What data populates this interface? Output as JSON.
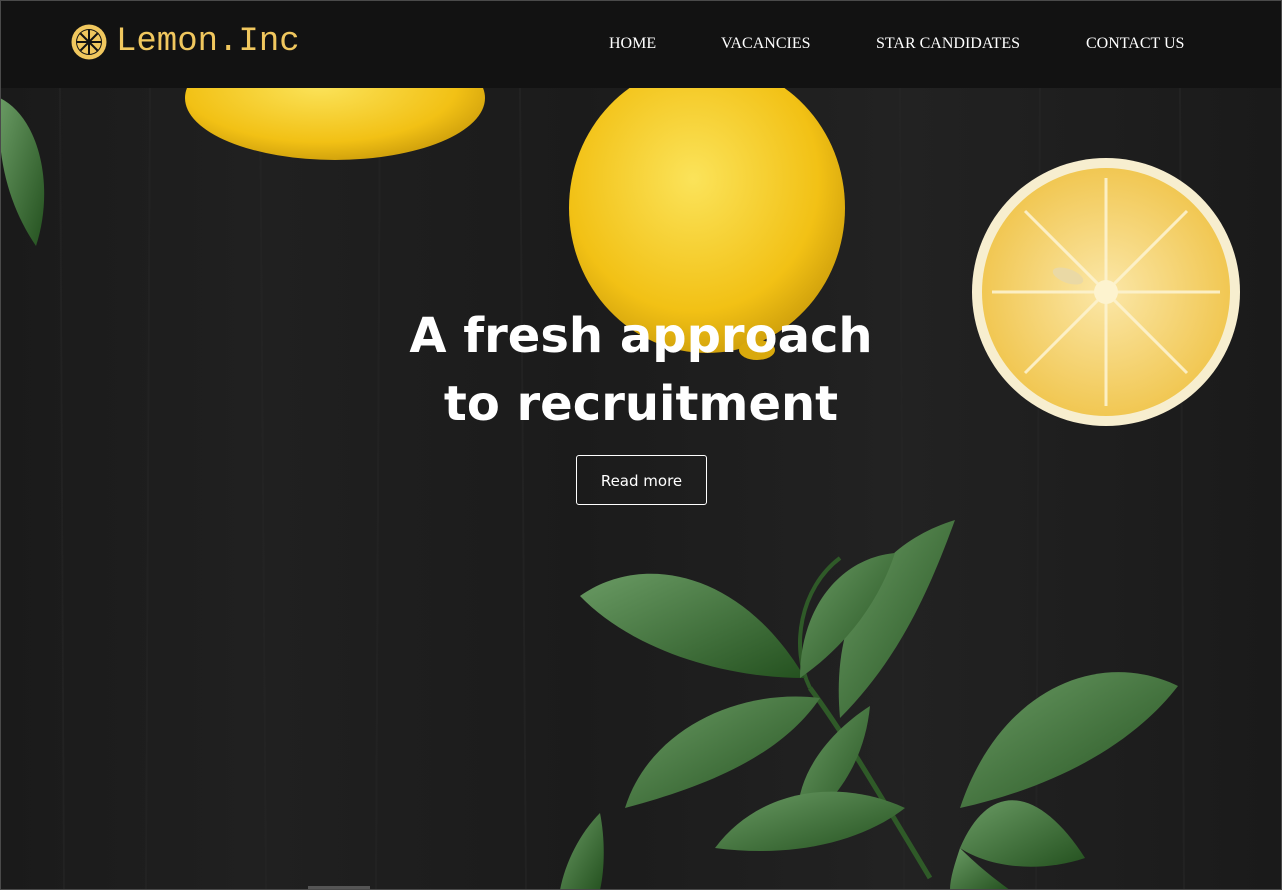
{
  "brand": {
    "name": "Lemon.Inc",
    "accent": "#f0c75e",
    "icon": "lemon-slice-icon"
  },
  "nav": {
    "items": [
      {
        "label": "HOME"
      },
      {
        "label": "VACANCIES"
      },
      {
        "label": "STAR CANDIDATES"
      },
      {
        "label": "CONTACT US"
      }
    ]
  },
  "hero": {
    "headline_line1": "A fresh approach",
    "headline_line2": "to recruitment",
    "cta_label": "Read more"
  },
  "colors": {
    "navbar": "#121212",
    "background": "#1c1c1c",
    "lemon": "#f5c91a",
    "leaf": "#3e7a3a"
  }
}
